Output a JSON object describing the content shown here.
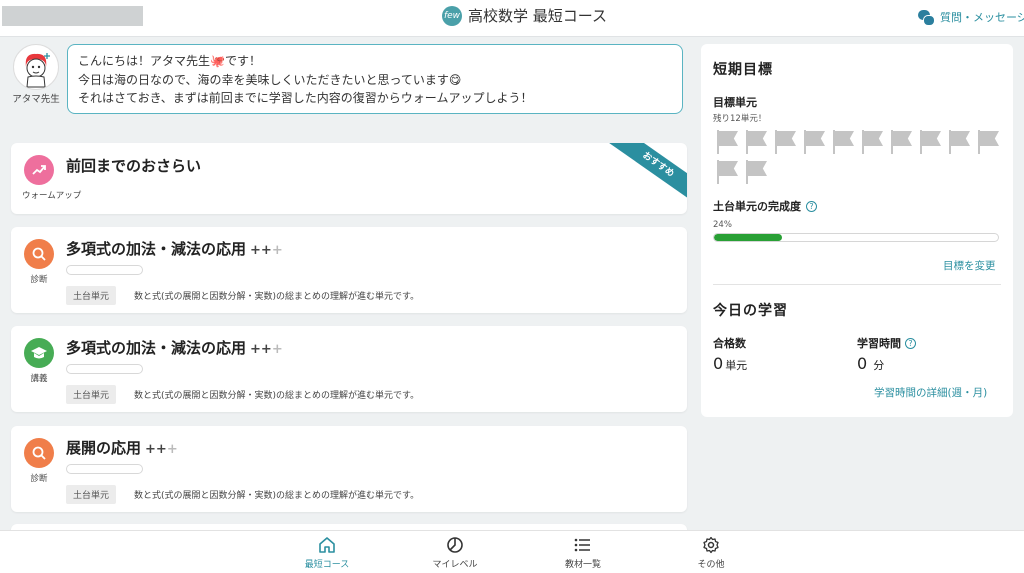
{
  "header": {
    "logo_text": "few",
    "app_title": "高校数学 最短コース",
    "messages_link": "質問・メッセージ"
  },
  "teacher": {
    "name": "アタマ先生",
    "message_lines": [
      "こんにちは！アタマ先生🐙です！",
      "今日は海の日なので、海の幸を美味しくいただきたいと思っています😋",
      "それはさておき、まずは前回までに学習した内容の復習からウォームアップしよう！"
    ]
  },
  "cards": [
    {
      "title": "前回までのおさらい",
      "icon": "trend-up-icon",
      "icon_label": "ウォームアップ",
      "color": "#ee6f9d",
      "ribbon": "おすすめ"
    },
    {
      "title": "多項式の加法・減法の応用",
      "plus_filled": "++",
      "plus_dim": "+",
      "icon": "search-icon",
      "icon_label": "診断",
      "color": "#f07e4a",
      "tag": "土台単元",
      "description": "数と式(式の展開と因数分解・実数)の総まとめの理解が進む単元です。"
    },
    {
      "title": "多項式の加法・減法の応用",
      "plus_filled": "++",
      "plus_dim": "+",
      "icon": "graduation-cap-icon",
      "icon_label": "講義",
      "color": "#47ac55",
      "tag": "土台単元",
      "description": "数と式(式の展開と因数分解・実数)の総まとめの理解が進む単元です。"
    },
    {
      "title": "展開の応用",
      "plus_filled": "++",
      "plus_dim": "+",
      "icon": "search-icon",
      "icon_label": "診断",
      "color": "#f07e4a",
      "tag": "土台単元",
      "description": "数と式(式の展開と因数分解・実数)の総まとめの理解が進む単元です。"
    }
  ],
  "short_goal": {
    "heading": "短期目標",
    "target_label": "目標単元",
    "remaining": "残り12単元！",
    "flag_count": 12,
    "completion_label": "土台単元の完成度",
    "completion_percent_text": "24%",
    "completion_fraction": 0.24,
    "change_link": "目標を変更"
  },
  "today": {
    "heading": "今日の学習",
    "passed_label": "合格数",
    "passed_value": "0",
    "passed_unit": "単元",
    "time_label": "学習時間",
    "time_value": "0",
    "time_unit": "分",
    "detail_link": "学習時間の詳細(週・月)"
  },
  "bottom_nav": [
    {
      "label": "最短コース",
      "icon": "home-icon",
      "active": true
    },
    {
      "label": "マイレベル",
      "icon": "pie-icon",
      "active": false
    },
    {
      "label": "教材一覧",
      "icon": "list-icon",
      "active": false
    },
    {
      "label": "その他",
      "icon": "gear-icon",
      "active": false
    }
  ],
  "colors": {
    "accent": "#2b8fa0",
    "progress": "#29a035",
    "background": "#eef1f2"
  }
}
